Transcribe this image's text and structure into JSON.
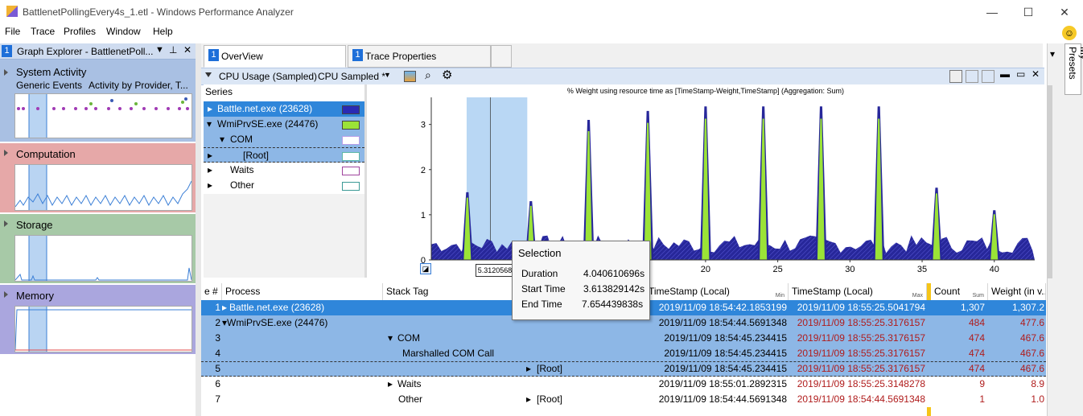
{
  "window": {
    "title": "BattlenetPollingEvery4s_1.etl - Windows Performance Analyzer",
    "minimize": "—",
    "maximize": "☐",
    "close": "✕"
  },
  "menu": [
    "File",
    "Trace",
    "Profiles",
    "Window",
    "Help"
  ],
  "graph_explorer": {
    "badge": "1",
    "title": "Graph Explorer - BattlenetPoll...",
    "categories": [
      {
        "name": "System Activity",
        "sub1": "Generic Events",
        "sub2": "Activity by Provider, T..."
      },
      {
        "name": "Computation"
      },
      {
        "name": "Storage"
      },
      {
        "name": "Memory"
      }
    ]
  },
  "tabs": [
    {
      "badge": "1",
      "label": "OverView"
    },
    {
      "badge": "1",
      "label": "Trace Properties"
    }
  ],
  "toolbar": {
    "graph_title": "CPU Usage (Sampled)",
    "preset": "CPU Sampled *"
  },
  "series": {
    "header": "Series",
    "items": [
      {
        "label": "Battle.net.exe (23628)",
        "color": "#2a2ab4"
      },
      {
        "label": "WmiPrvSE.exe (24476)",
        "color": "#9be337"
      },
      {
        "label": "COM",
        "color": "#b79ee8"
      },
      {
        "label": "[Root]",
        "color": "#98d4c7"
      },
      {
        "label": "Waits",
        "color": "#b06ab0"
      },
      {
        "label": "Other",
        "color": "#6cb9b5"
      }
    ]
  },
  "chart_data": {
    "type": "area",
    "title": "% Weight using resource time as [TimeStamp-Weight,TimeStamp] (Aggregation: Sum)",
    "y_ticks": [
      "0",
      "1",
      "2",
      "3"
    ],
    "x_ticks": [
      "20",
      "25",
      "30",
      "35",
      "40"
    ],
    "ylim": [
      0,
      3.6
    ],
    "selection_start_label": "5.3120568",
    "series": [
      {
        "name": "Battle.net.exe (23628)",
        "color": "#2a2ab4"
      },
      {
        "name": "WmiPrvSE.exe (24476)",
        "color": "#9be337"
      }
    ],
    "peaks": [
      {
        "x": 3.5,
        "y": 1.5
      },
      {
        "x": 7.9,
        "y": 1.3
      },
      {
        "x": 11.9,
        "y": 3.1
      },
      {
        "x": 16.0,
        "y": 3.3
      },
      {
        "x": 20.0,
        "y": 3.4
      },
      {
        "x": 24.0,
        "y": 3.4
      },
      {
        "x": 28.0,
        "y": 3.4
      },
      {
        "x": 32.0,
        "y": 3.4
      },
      {
        "x": 36.0,
        "y": 1.6
      },
      {
        "x": 40.0,
        "y": 1.1
      }
    ]
  },
  "tooltip": {
    "title": "Selection",
    "rows": [
      {
        "label": "Duration",
        "value": "4.040610696s"
      },
      {
        "label": "Start Time",
        "value": "3.613829142s"
      },
      {
        "label": "End Time",
        "value": "7.654439838s"
      }
    ]
  },
  "table": {
    "headers": {
      "line": "e #",
      "process": "Process",
      "stack": "Stack Tag",
      "ts_min": "TimeStamp (Local)",
      "ts_min_sub": "Min",
      "ts_max": "TimeStamp (Local)",
      "ts_max_sub": "Max",
      "count": "Count",
      "count_sub": "Sum",
      "weight": "Weight (in v..."
    },
    "rows": [
      {
        "n": "1",
        "process": "Battle.net.exe (23628)",
        "stack": "",
        "stack2": "",
        "ts_min": "2019/11/09 18:54:42.1853199",
        "ts_max": "2019/11/09 18:55:25.5041794",
        "count": "1,307",
        "weight": "1,307.2"
      },
      {
        "n": "2",
        "process": "WmiPrvSE.exe (24476)",
        "stack": "",
        "stack2": "",
        "ts_min": "2019/11/09 18:54:44.5691348",
        "ts_max": "2019/11/09 18:55:25.3176157",
        "count": "484",
        "weight": "477.6"
      },
      {
        "n": "3",
        "process": "",
        "stack": "COM",
        "stack2": "",
        "ts_min": "2019/11/09 18:54:45.234415",
        "ts_max": "2019/11/09 18:55:25.3176157",
        "count": "474",
        "weight": "467.6"
      },
      {
        "n": "4",
        "process": "",
        "stack": "Marshalled COM Call",
        "stack2": "",
        "ts_min": "2019/11/09 18:54:45.234415",
        "ts_max": "2019/11/09 18:55:25.3176157",
        "count": "474",
        "weight": "467.6"
      },
      {
        "n": "5",
        "process": "",
        "stack": "",
        "stack2": "[Root]",
        "ts_min": "2019/11/09 18:54:45.234415",
        "ts_max": "2019/11/09 18:55:25.3176157",
        "count": "474",
        "weight": "467.6"
      },
      {
        "n": "6",
        "process": "",
        "stack": "Waits",
        "stack2": "",
        "ts_min": "2019/11/09 18:55:01.2892315",
        "ts_max": "2019/11/09 18:55:25.3148278",
        "count": "9",
        "weight": "8.9"
      },
      {
        "n": "7",
        "process": "",
        "stack": "Other",
        "stack2": "[Root]",
        "ts_min": "2019/11/09 18:54:44.5691348",
        "ts_max": "2019/11/09 18:54:44.5691348",
        "count": "1",
        "weight": "1.0"
      }
    ]
  },
  "right_panel": {
    "presets_label": "My Presets"
  }
}
